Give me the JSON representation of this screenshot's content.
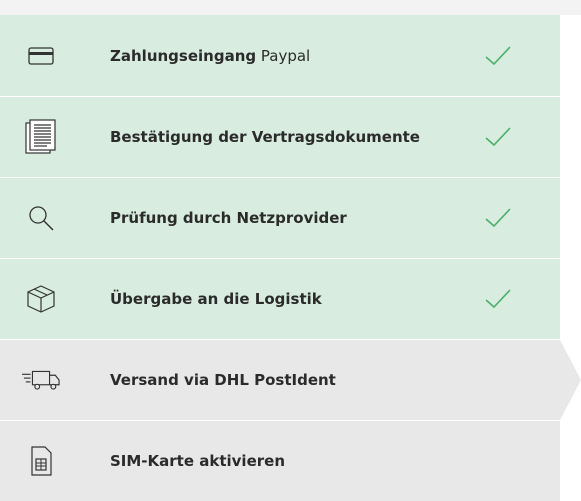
{
  "steps": [
    {
      "title": "Zahlungseingang",
      "suffix": "Paypal",
      "icon": "credit-card-icon",
      "status": "done"
    },
    {
      "title": "Bestätigung der Vertragsdokumente",
      "icon": "document-icon",
      "status": "done"
    },
    {
      "title": "Prüfung durch Netzprovider",
      "icon": "search-icon",
      "status": "done"
    },
    {
      "title": "Übergabe an die Logistik",
      "icon": "package-icon",
      "status": "done"
    },
    {
      "title": "Versand via DHL PostIdent",
      "icon": "truck-icon",
      "status": "active"
    },
    {
      "title": "SIM-Karte aktivieren",
      "icon": "sim-card-icon",
      "status": "pending"
    }
  ],
  "colors": {
    "done_bg": "#d8ede0",
    "pending_bg": "#e8e8e8",
    "check": "#4caf6a",
    "text": "#2b2b2b"
  }
}
